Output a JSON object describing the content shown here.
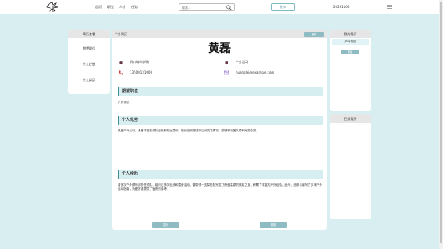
{
  "header": {
    "nav": [
      "首页",
      "职位",
      "人才",
      "任务"
    ],
    "search_placeholder": "搜索...",
    "post_label": "发布",
    "user_id": "20201106"
  },
  "sidebar": {
    "title": "简历查看",
    "items": [
      "期望职位",
      "个人优势",
      "个人经历"
    ]
  },
  "main": {
    "header_label": "户外简历",
    "edit_label": "编辑",
    "name": "黄磊",
    "school": "四川城市学院",
    "job": "户外运动",
    "phone": "13500131000",
    "email": "huanglei@example.com",
    "sections": [
      {
        "title": "期望职位",
        "content": "户外领队"
      },
      {
        "title": "个人优势",
        "content": "热爱户外活动，具备丰富的领队经验和安全意识，擅长组织路线和应对突发情况，能够带领团队顺利完成任务。"
      },
      {
        "title": "个人经历",
        "content": "曾多次户外俱乐部担任领队，组织过多次徒步和露营活动，曾带领一支探险队完成了贵藏高原的穿越之旅，积累了丰富的户外经验。此外，还参与编写了多本户外运动指南，为爱好者提供了宝贵的参考。"
      }
    ],
    "apply_label": "发布",
    "delete_label": "删除"
  },
  "right": {
    "my_resumes_title": "我的简历",
    "resume_item": "户外简历",
    "new_label": "新建",
    "history_title": "已投简历"
  }
}
